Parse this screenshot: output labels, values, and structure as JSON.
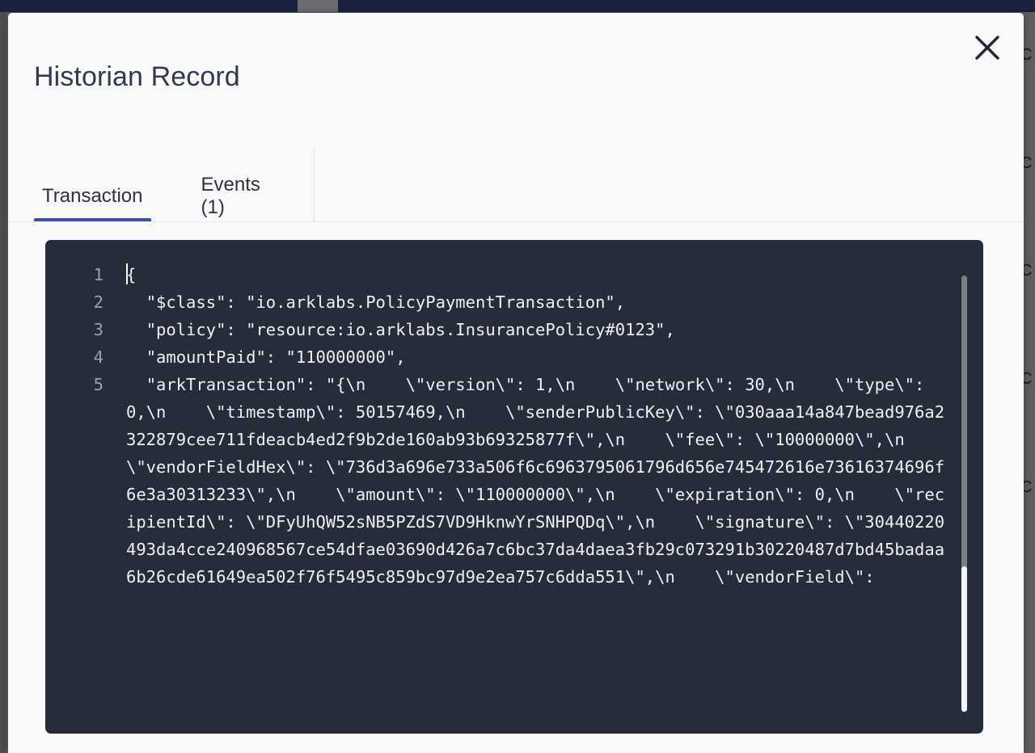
{
  "window": {
    "top_bar_color": "#1b2240",
    "background_color": "#5f6062"
  },
  "background": {
    "right_column_glyphs": [
      "C",
      "C",
      "C",
      "C",
      "C"
    ]
  },
  "modal": {
    "title": "Historian Record",
    "close_icon": "close-icon",
    "accent_color": "#3f4db3",
    "surface_color": "#f9f9fa"
  },
  "tabs": [
    {
      "label": "Transaction",
      "active": true
    },
    {
      "label": "Events (1)",
      "active": false
    }
  ],
  "code_viewer": {
    "background_color": "#262c3a",
    "text_color": "#eef0f3",
    "gutter_color": "#9aa1ad",
    "caret_visible": true,
    "lines": [
      {
        "number": "1",
        "text": "{"
      },
      {
        "number": "2",
        "text": "  \"$class\": \"io.arklabs.PolicyPaymentTransaction\","
      },
      {
        "number": "3",
        "text": "  \"policy\": \"resource:io.arklabs.InsurancePolicy#0123\","
      },
      {
        "number": "4",
        "text": "  \"amountPaid\": \"110000000\","
      },
      {
        "number": "5",
        "text": "  \"arkTransaction\": \"{\\n    \\\"version\\\": 1,\\n    \\\"network\\\": 30,\\n    \\\"type\\\": 0,\\n    \\\"timestamp\\\": 50157469,\\n    \\\"senderPublicKey\\\": \\\"030aaa14a847bead976a2322879cee711fdeacb4ed2f9b2de160ab93b69325877f\\\",\\n    \\\"fee\\\": \\\"10000000\\\",\\n    \\\"vendorFieldHex\\\": \\\"736d3a696e733a506f6c6963795061796d656e745472616e73616374696f6e3a30313233\\\",\\n    \\\"amount\\\": \\\"110000000\\\",\\n    \\\"expiration\\\": 0,\\n    \\\"recipientId\\\": \\\"DFyUhQW52sNB5PZdS7VD9HknwYrSNHPQDq\\\",\\n    \\\"signature\\\": \\\"30440220493da4cce240968567ce54dfae03690d426a7c6bc37da4daea3fb29c073291b30220487d7bd45badaa6b26cde61649ea502f76f5495c859bc97d9e2ea757c6dda551\\\",\\n    \\\"vendorField\\\":"
      }
    ],
    "scrollbar": {
      "name": "vertical-scrollbar"
    }
  }
}
